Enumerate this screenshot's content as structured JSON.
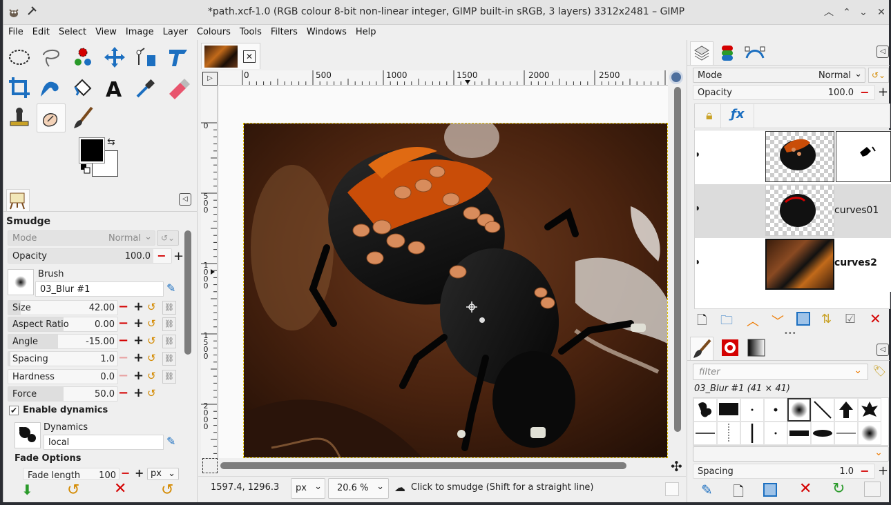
{
  "window": {
    "title": "*path.xcf-1.0 (RGB colour 8-bit non-linear integer, GIMP built-in sRGB, 3 layers) 3312x2481 – GIMP",
    "controls": [
      "︿",
      "⌃",
      "⌄",
      "✕"
    ]
  },
  "menu": [
    "File",
    "Edit",
    "Select",
    "View",
    "Image",
    "Layer",
    "Colours",
    "Tools",
    "Filters",
    "Windows",
    "Help"
  ],
  "tool_options": {
    "title": "Smudge",
    "mode_label": "Mode",
    "mode_value": "Normal",
    "opacity_label": "Opacity",
    "opacity_value": "100.0",
    "brush_label": "Brush",
    "brush_name": "03_Blur #1",
    "size_label": "Size",
    "size_value": "42.00",
    "aspect_label": "Aspect Ratio",
    "aspect_value": "0.00",
    "angle_label": "Angle",
    "angle_value": "-15.00",
    "spacing_label": "Spacing",
    "spacing_value": "1.0",
    "hardness_label": "Hardness",
    "hardness_value": "0.0",
    "force_label": "Force",
    "force_value": "50.0",
    "dynamics_toggle": "Enable dynamics",
    "dynamics_label": "Dynamics",
    "dynamics_value": "local",
    "fade_options": "Fade Options",
    "fade_length_label": "Fade length",
    "fade_length_value": "100",
    "fade_unit": "px"
  },
  "rulers": {
    "h_labels": [
      "0",
      "500",
      "1000",
      "1500",
      "2000",
      "2500"
    ],
    "v_labels": [
      [
        "0"
      ],
      [
        "5",
        "0",
        "0"
      ],
      [
        "1",
        "0",
        "0",
        "0"
      ],
      [
        "1",
        "5",
        "0",
        "0"
      ],
      [
        "2",
        "0",
        "0",
        "0"
      ]
    ]
  },
  "status": {
    "coords": "1597.4, 1296.3",
    "unit": "px",
    "zoom": "20.6 %",
    "message": "Click to smudge (Shift for a straight line)"
  },
  "layers_panel": {
    "mode_label": "Mode",
    "mode_value": "Normal",
    "opacity_label": "Opacity",
    "opacity_value": "100.0",
    "layers": [
      {
        "name": ""
      },
      {
        "name": "curves01"
      },
      {
        "name": "curves2"
      }
    ]
  },
  "brushes_panel": {
    "filter_placeholder": "filter",
    "current_brush": "03_Blur #1 (41 × 41)",
    "spacing_label": "Spacing",
    "spacing_value": "1.0"
  },
  "colors": {
    "accent_red": "#d40000",
    "accent_orange": "#ee7a00",
    "accent_blue": "#1c6fc0"
  }
}
